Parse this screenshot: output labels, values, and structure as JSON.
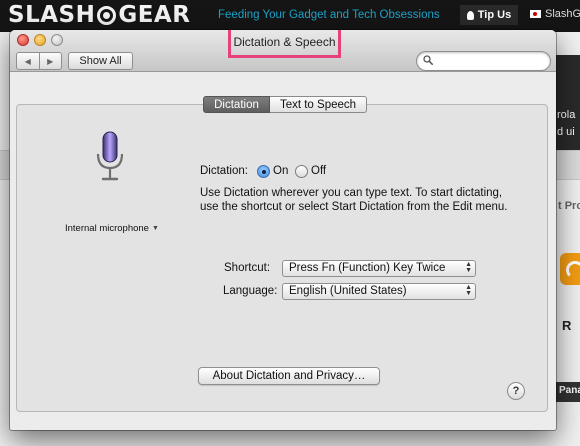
{
  "site": {
    "logo_left": "SLASH",
    "logo_right": "GEAR",
    "tagline": "Feeding Your Gadget and Tech Obsessions",
    "tip_label": "Tip Us",
    "right_link": "SlashG",
    "right_snippets": [
      "rola",
      "d ui"
    ],
    "side_labels": [
      "t Pro",
      "R",
      "Pana"
    ]
  },
  "window": {
    "title": "Dictation & Speech",
    "toolbar": {
      "back_glyph": "◀",
      "forward_glyph": "▶",
      "show_all_label": "Show All",
      "search_value": "",
      "search_placeholder": ""
    },
    "tabs": [
      {
        "label": "Dictation",
        "selected": true
      },
      {
        "label": "Text to Speech",
        "selected": false
      }
    ],
    "mic_label": "Internal microphone",
    "mic_arrow": "▼",
    "dictation": {
      "label": "Dictation:",
      "options": [
        {
          "label": "On",
          "selected": true
        },
        {
          "label": "Off",
          "selected": false
        }
      ],
      "description": "Use Dictation wherever you can type text. To start dictating, use the shortcut or select Start Dictation from the Edit menu."
    },
    "shortcut": {
      "label": "Shortcut:",
      "value": "Press Fn (Function) Key Twice"
    },
    "language": {
      "label": "Language:",
      "value": "English (United States)"
    },
    "about_button": "About Dictation and Privacy…",
    "help_glyph": "?"
  },
  "colors": {
    "highlight_border": "#e6417c",
    "tagline": "#1ea3c9",
    "selected_tab": "#6b6b6b",
    "radio_selected": "#3d89e0"
  }
}
